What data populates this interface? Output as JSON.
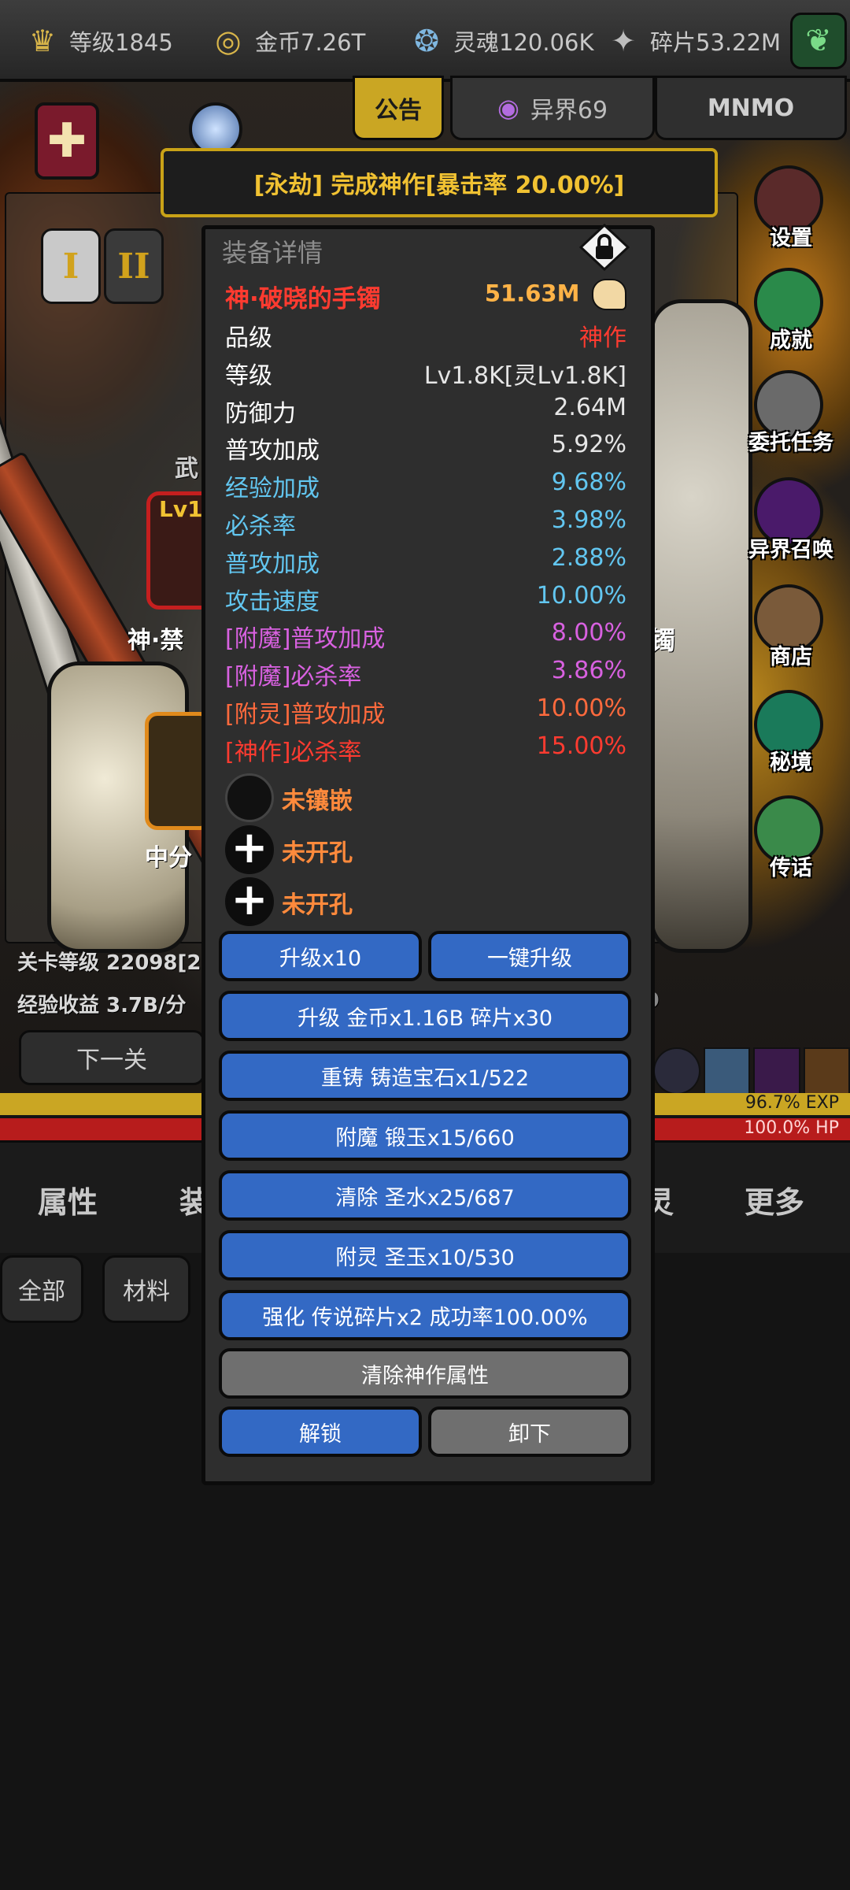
{
  "topbar": {
    "resources": [
      {
        "icon": "crown-icon",
        "label": "等级1845"
      },
      {
        "icon": "gold-coin-icon",
        "label": "金币7.26T"
      },
      {
        "icon": "soul-icon",
        "label": "灵魂120.06K"
      },
      {
        "icon": "shard-icon",
        "label": "碎片53.22M"
      }
    ],
    "tabs": {
      "notice": "公告",
      "other_world": "异界69",
      "mnmo": "MNMO"
    }
  },
  "announcement": "[永劫] 完成神作[暴击率 20.00%]",
  "roman_tabs": [
    "I",
    "II"
  ],
  "side_menu": [
    "设置",
    "成就",
    "委托任务",
    "异界召唤",
    "商店",
    "秘境",
    "传话"
  ],
  "background": {
    "weapon_partial": "武",
    "lv_partial": "Lv1",
    "item_name_partial": "神·禁",
    "bracelet_partial": "镯",
    "mid_partial": "中分",
    "stage_level": "关卡等级 22098[2",
    "exp_income": "经验收益 3.7B/分",
    "exp_income_tail": "9",
    "next_stage": "下一关",
    "exp_percent": "96.7% EXP",
    "hp_percent": "100.0%  HP"
  },
  "bottom_nav": [
    "属性",
    "装",
    "灵",
    "更多"
  ],
  "filters": [
    "全部",
    "材料"
  ],
  "modal": {
    "title": "装备详情",
    "item_name": "神·破晓的手镯",
    "power": "51.63M",
    "stats": [
      {
        "k": "品级",
        "v": "神作",
        "kc": "#ffffff",
        "vc": "#ff3b30"
      },
      {
        "k": "等级",
        "v": "Lv1.8K[灵Lv1.8K]",
        "kc": "#ffffff",
        "vc": "#e6e6e6"
      },
      {
        "k": "防御力",
        "v": "2.64M",
        "kc": "#ffffff",
        "vc": "#e6e6e6"
      },
      {
        "k": "普攻加成",
        "v": "5.92%",
        "kc": "#ffffff",
        "vc": "#e6e6e6"
      },
      {
        "k": "经验加成",
        "v": "9.68%",
        "kc": "#62c6f0",
        "vc": "#62c6f0"
      },
      {
        "k": "必杀率",
        "v": "3.98%",
        "kc": "#62c6f0",
        "vc": "#62c6f0"
      },
      {
        "k": "普攻加成",
        "v": "2.88%",
        "kc": "#62c6f0",
        "vc": "#62c6f0"
      },
      {
        "k": "攻击速度",
        "v": "10.00%",
        "kc": "#62c6f0",
        "vc": "#62c6f0"
      },
      {
        "k": "[附魔]普攻加成",
        "v": "8.00%",
        "kc": "#d861e0",
        "vc": "#d861e0"
      },
      {
        "k": "[附魔]必杀率",
        "v": "3.86%",
        "kc": "#d861e0",
        "vc": "#d861e0"
      },
      {
        "k": "[附灵]普攻加成",
        "v": "10.00%",
        "kc": "#ff6a3d",
        "vc": "#ff6a3d"
      },
      {
        "k": "[神作]必杀率",
        "v": "15.00%",
        "kc": "#ff3b30",
        "vc": "#ff3b30"
      }
    ],
    "sockets": [
      {
        "label": "未镶嵌",
        "type": "empty"
      },
      {
        "label": "未开孔",
        "type": "plus"
      },
      {
        "label": "未开孔",
        "type": "plus"
      }
    ],
    "buttons": {
      "upgrade10": "升级x10",
      "one_key_upgrade": "一键升级",
      "upgrade": "升级 金币x1.16B 碎片x30",
      "recast": "重铸 铸造宝石x1/522",
      "enchant": "附魔 锻玉x15/660",
      "clear": "清除 圣水x25/687",
      "spirit": "附灵 圣玉x10/530",
      "strengthen": "强化 传说碎片x2 成功率100.00%",
      "clear_artifact": "清除神作属性",
      "unlock": "解锁",
      "unequip": "卸下"
    },
    "colors": {
      "item_name": "#ff3b30",
      "power": "#ffb347",
      "button_blue": "#3369c4",
      "button_gray": "#6f6f6f"
    }
  }
}
